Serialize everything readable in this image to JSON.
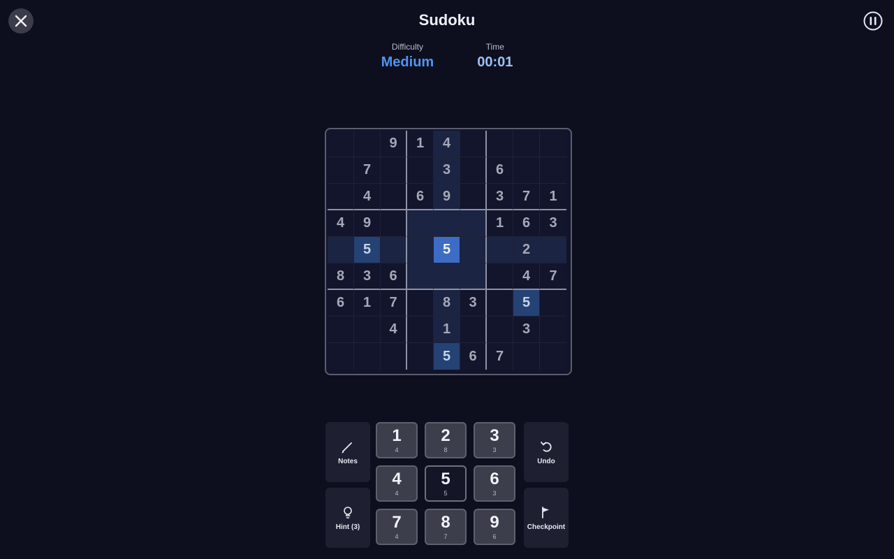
{
  "header": {
    "title": "Sudoku",
    "difficulty_label": "Difficulty",
    "difficulty_value": "Medium",
    "time_label": "Time",
    "time_value": "00:01"
  },
  "board": {
    "rows": [
      [
        "",
        "",
        "9",
        "1",
        "4",
        "",
        "",
        "",
        ""
      ],
      [
        "",
        "7",
        "",
        "",
        "3",
        "",
        "6",
        "",
        ""
      ],
      [
        "",
        "4",
        "",
        "6",
        "9",
        "",
        "3",
        "7",
        "1"
      ],
      [
        "4",
        "9",
        "",
        "",
        "",
        "",
        "1",
        "6",
        "3"
      ],
      [
        "",
        "5",
        "",
        "",
        "5",
        "",
        "",
        "2",
        ""
      ],
      [
        "8",
        "3",
        "6",
        "",
        "",
        "",
        "",
        "4",
        "7"
      ],
      [
        "6",
        "1",
        "7",
        "",
        "8",
        "3",
        "",
        "5",
        ""
      ],
      [
        "",
        "",
        "4",
        "",
        "1",
        "",
        "",
        "3",
        ""
      ],
      [
        "",
        "",
        "",
        "",
        "5",
        "6",
        "7",
        "",
        ""
      ]
    ],
    "selected": [
      4,
      4
    ],
    "same_value_cells": [
      [
        4,
        1
      ],
      [
        6,
        7
      ],
      [
        8,
        4
      ]
    ]
  },
  "controls": {
    "notes_label": "Notes",
    "hint_label": "Hint (3)",
    "undo_label": "Undo",
    "checkpoint_label": "Checkpoint"
  },
  "numpad": [
    {
      "digit": "1",
      "count": "4"
    },
    {
      "digit": "2",
      "count": "8"
    },
    {
      "digit": "3",
      "count": "3"
    },
    {
      "digit": "4",
      "count": "4"
    },
    {
      "digit": "5",
      "count": "5"
    },
    {
      "digit": "6",
      "count": "3"
    },
    {
      "digit": "7",
      "count": "4"
    },
    {
      "digit": "8",
      "count": "7"
    },
    {
      "digit": "9",
      "count": "6"
    }
  ],
  "colors": {
    "accent": "#4f95ee",
    "selected_cell": "#3d6cc4",
    "background": "#0d0f1f"
  }
}
